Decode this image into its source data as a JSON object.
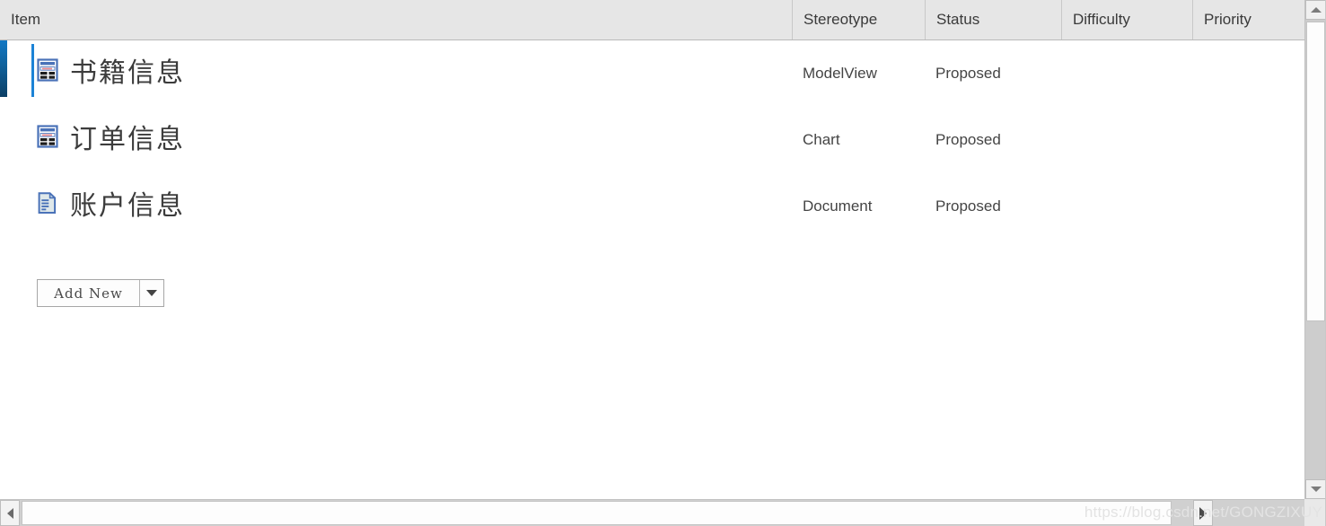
{
  "grid": {
    "columns": [
      {
        "key": "item",
        "label": "Item"
      },
      {
        "key": "stereotype",
        "label": "Stereotype"
      },
      {
        "key": "status",
        "label": "Status"
      },
      {
        "key": "difficulty",
        "label": "Difficulty"
      },
      {
        "key": "priority",
        "label": "Priority"
      }
    ],
    "rows": [
      {
        "item": "书籍信息",
        "icon": "modelview-diagram-icon",
        "stereotype": "ModelView",
        "status": "Proposed",
        "difficulty": "",
        "priority": "",
        "selected": true
      },
      {
        "item": "订单信息",
        "icon": "chart-diagram-icon",
        "stereotype": "Chart",
        "status": "Proposed",
        "difficulty": "",
        "priority": "",
        "selected": false
      },
      {
        "item": "账户信息",
        "icon": "document-page-icon",
        "stereotype": "Document",
        "status": "Proposed",
        "difficulty": "",
        "priority": "",
        "selected": false
      }
    ]
  },
  "add_new_button": {
    "label": "Add  New",
    "dropdown_icon": "chevron-down-icon"
  },
  "scrollbars": {
    "vertical": {
      "up_icon": "triangle-up-icon",
      "down_icon": "triangle-down-icon"
    },
    "horizontal": {
      "left_icon": "triangle-left-icon",
      "right_icon": "triangle-right-icon"
    }
  },
  "watermark": {
    "text": "https://blog.csdn.net/GONGZIXUY"
  },
  "colors": {
    "header_bg": "#e6e6e6",
    "selection_bar": "#1278c4",
    "row_accent": "#1c83d6",
    "icon_blue": "#4a72b8",
    "text": "#3c3c3c"
  }
}
